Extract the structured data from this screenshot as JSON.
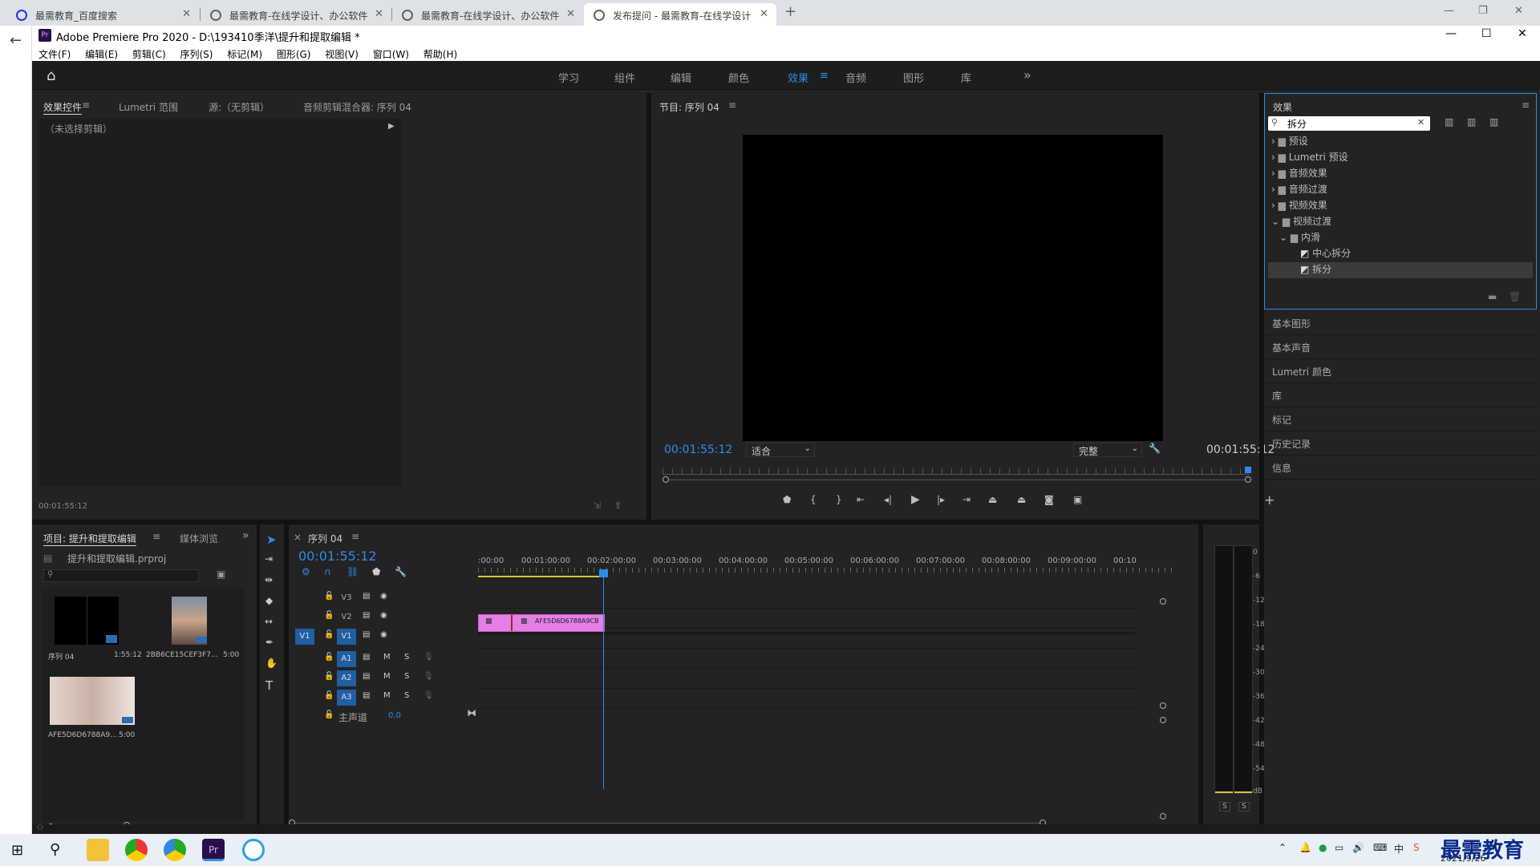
{
  "browser": {
    "tabs": [
      {
        "title": "最需教育_百度搜索"
      },
      {
        "title": "最需教育-在线学设计、办公软件"
      },
      {
        "title": "最需教育-在线学设计、办公软件"
      },
      {
        "title": "发布提问 - 最需教育-在线学设计"
      }
    ],
    "new_tab": "+"
  },
  "app": {
    "title": "Adobe Premiere Pro 2020 - D:\\193410季洋\\提升和提取编辑 *",
    "menu": [
      "文件(F)",
      "编辑(E)",
      "剪辑(C)",
      "序列(S)",
      "标记(M)",
      "图形(G)",
      "视图(V)",
      "窗口(W)",
      "帮助(H)"
    ],
    "workspaces": [
      "学习",
      "组件",
      "编辑",
      "颜色",
      "效果",
      "音频",
      "图形",
      "库"
    ],
    "active_workspace": "效果"
  },
  "source_panel": {
    "tabs": [
      "效果控件",
      "Lumetri 范围",
      "源:（无剪辑）",
      "音频剪辑混合器: 序列 04"
    ],
    "no_clip": "（未选择剪辑）",
    "timecode": "00:01:55:12"
  },
  "program": {
    "title": "节目: 序列 04",
    "timecode_left": "00:01:55:12",
    "fit": "适合",
    "quality": "完整",
    "timecode_right": "00:01:55:12"
  },
  "effects": {
    "title": "效果",
    "search_value": "拆分",
    "tree": [
      {
        "label": "预设",
        "indent": 0,
        "expanded": false,
        "type": "folder"
      },
      {
        "label": "Lumetri 预设",
        "indent": 0,
        "expanded": false,
        "type": "folder"
      },
      {
        "label": "音频效果",
        "indent": 0,
        "expanded": false,
        "type": "folder"
      },
      {
        "label": "音频过渡",
        "indent": 0,
        "expanded": false,
        "type": "folder"
      },
      {
        "label": "视频效果",
        "indent": 0,
        "expanded": false,
        "type": "folder"
      },
      {
        "label": "视频过渡",
        "indent": 0,
        "expanded": true,
        "type": "folder"
      },
      {
        "label": "内滑",
        "indent": 1,
        "expanded": true,
        "type": "folder"
      },
      {
        "label": "中心拆分",
        "indent": 2,
        "type": "effect"
      },
      {
        "label": "拆分",
        "indent": 2,
        "type": "effect",
        "selected": true
      }
    ],
    "side_panels": [
      "基本图形",
      "基本声音",
      "Lumetri 颜色",
      "库",
      "标记",
      "历史记录",
      "信息"
    ]
  },
  "project": {
    "tabs": [
      "项目: 提升和提取编辑",
      "媒体浏览"
    ],
    "file": "提升和提取编辑.prproj",
    "items": [
      {
        "name": "序列 04",
        "duration": "1:55:12"
      },
      {
        "name": "2BB6CE15CEF3F7...",
        "duration": "5:00"
      },
      {
        "name": "AFE5D6D6788A9...",
        "duration": "5:00"
      }
    ]
  },
  "timeline": {
    "title": "序列 04",
    "timecode": "00:01:55:12",
    "ruler": [
      ":00:00",
      "00:01:00:00",
      "00:02:00:00",
      "00:03:00:00",
      "00:04:00:00",
      "00:05:00:00",
      "00:06:00:00",
      "00:07:00:00",
      "00:08:00:00",
      "00:09:00:00",
      "00:10"
    ],
    "video_tracks": [
      "V3",
      "V2",
      "V1"
    ],
    "audio_tracks": [
      "A1",
      "A2",
      "A3"
    ],
    "source_patch": "V1",
    "master": "主声道",
    "master_value": "0.0",
    "clip_label": "AFE5D6D6788A9CB",
    "ms_labels": [
      "M",
      "S"
    ]
  },
  "meter": {
    "scale": [
      "0",
      "-6",
      "-12",
      "-18",
      "-24",
      "-30",
      "-36",
      "-42",
      "-48",
      "-54",
      "dB"
    ],
    "solo": [
      "S",
      "S"
    ]
  },
  "taskbar": {
    "date": "2021/9/26",
    "ime": "中",
    "watermark": "最需教育"
  },
  "colors": {
    "accent": "#2d8ceb",
    "clip": "#e57fe5",
    "playhead": "#2d8ceb"
  }
}
